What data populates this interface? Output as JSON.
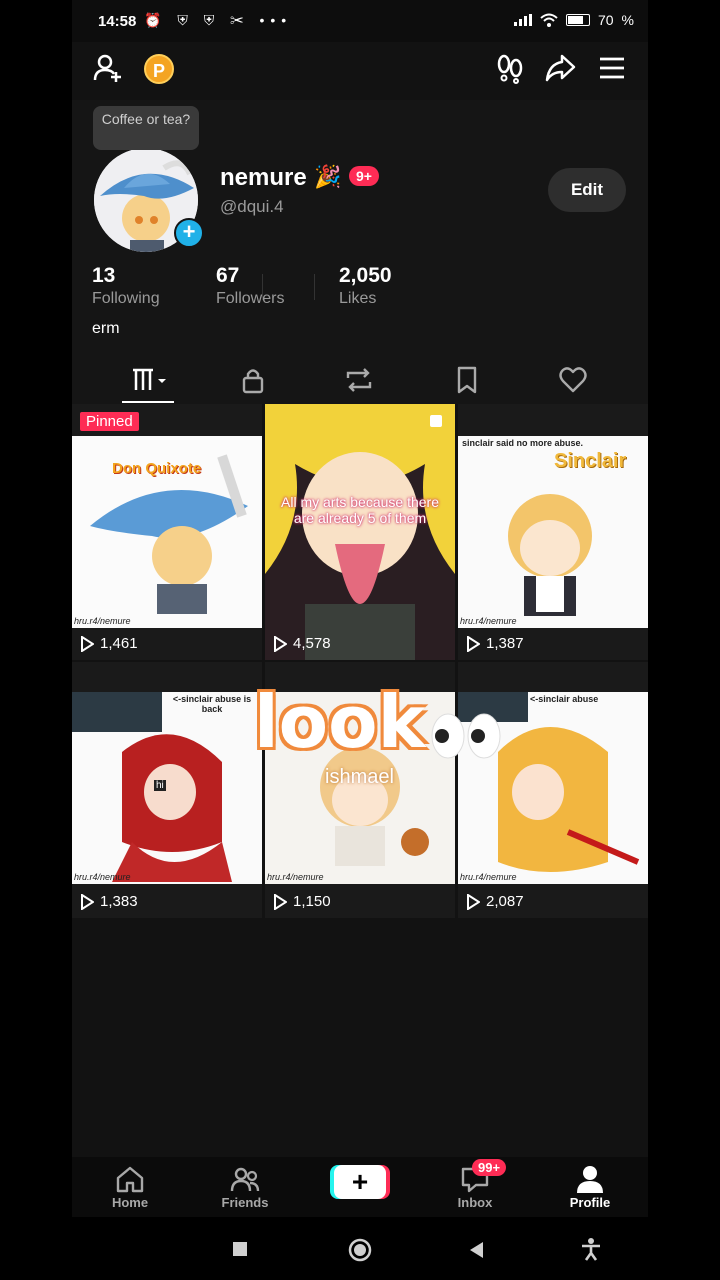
{
  "status": {
    "time": "14:58",
    "icons_left": "⏰ ⛨ ⛨ ✂ •••",
    "battery": "70"
  },
  "topbar": {
    "coin": "P"
  },
  "profile": {
    "tooltip": "Coffee or tea?",
    "name": "nemure",
    "name_emoji": "🎉",
    "badge": "9+",
    "handle": "@dqui.4",
    "edit_label": "Edit",
    "stats": [
      {
        "value": "13",
        "label": "Following"
      },
      {
        "value": "67",
        "label": "Followers"
      },
      {
        "value": "2,050",
        "label": "Likes"
      }
    ],
    "bio": "erm"
  },
  "tabs": [
    {
      "icon": "videos-grid-icon",
      "active": true
    },
    {
      "icon": "lock-icon"
    },
    {
      "icon": "repost-icon"
    },
    {
      "icon": "bookmark-icon"
    },
    {
      "icon": "heart-icon"
    }
  ],
  "videos": [
    {
      "views": "1,461",
      "pinned": "Pinned",
      "caption": "Don Quixote",
      "watermark": "hru.r4/nemure"
    },
    {
      "views": "4,578",
      "caption": "All my arts because there are already 5 of them"
    },
    {
      "views": "1,387",
      "caption": "sinclair said no more abuse.",
      "title": "Sinclair",
      "watermark": "hru.r4/nemure"
    },
    {
      "views": "1,383",
      "caption": "<-sinclair abuse is back",
      "sticker": "hi",
      "watermark": "hru.r4/nemure"
    },
    {
      "views": "1,150",
      "caption": "ishmael",
      "overlay": "look",
      "watermark": "hru.r4/nemure"
    },
    {
      "views": "2,087",
      "caption": "<-sinclair abuse",
      "watermark": "hru.r4/nemure"
    }
  ],
  "bottom_nav": {
    "home": "Home",
    "friends": "Friends",
    "create": "+",
    "inbox": "Inbox",
    "inbox_badge": "99+",
    "profile": "Profile"
  },
  "colors": {
    "accent": "#fe2c55",
    "cyan": "#25f4ee",
    "bg": "#121212"
  }
}
